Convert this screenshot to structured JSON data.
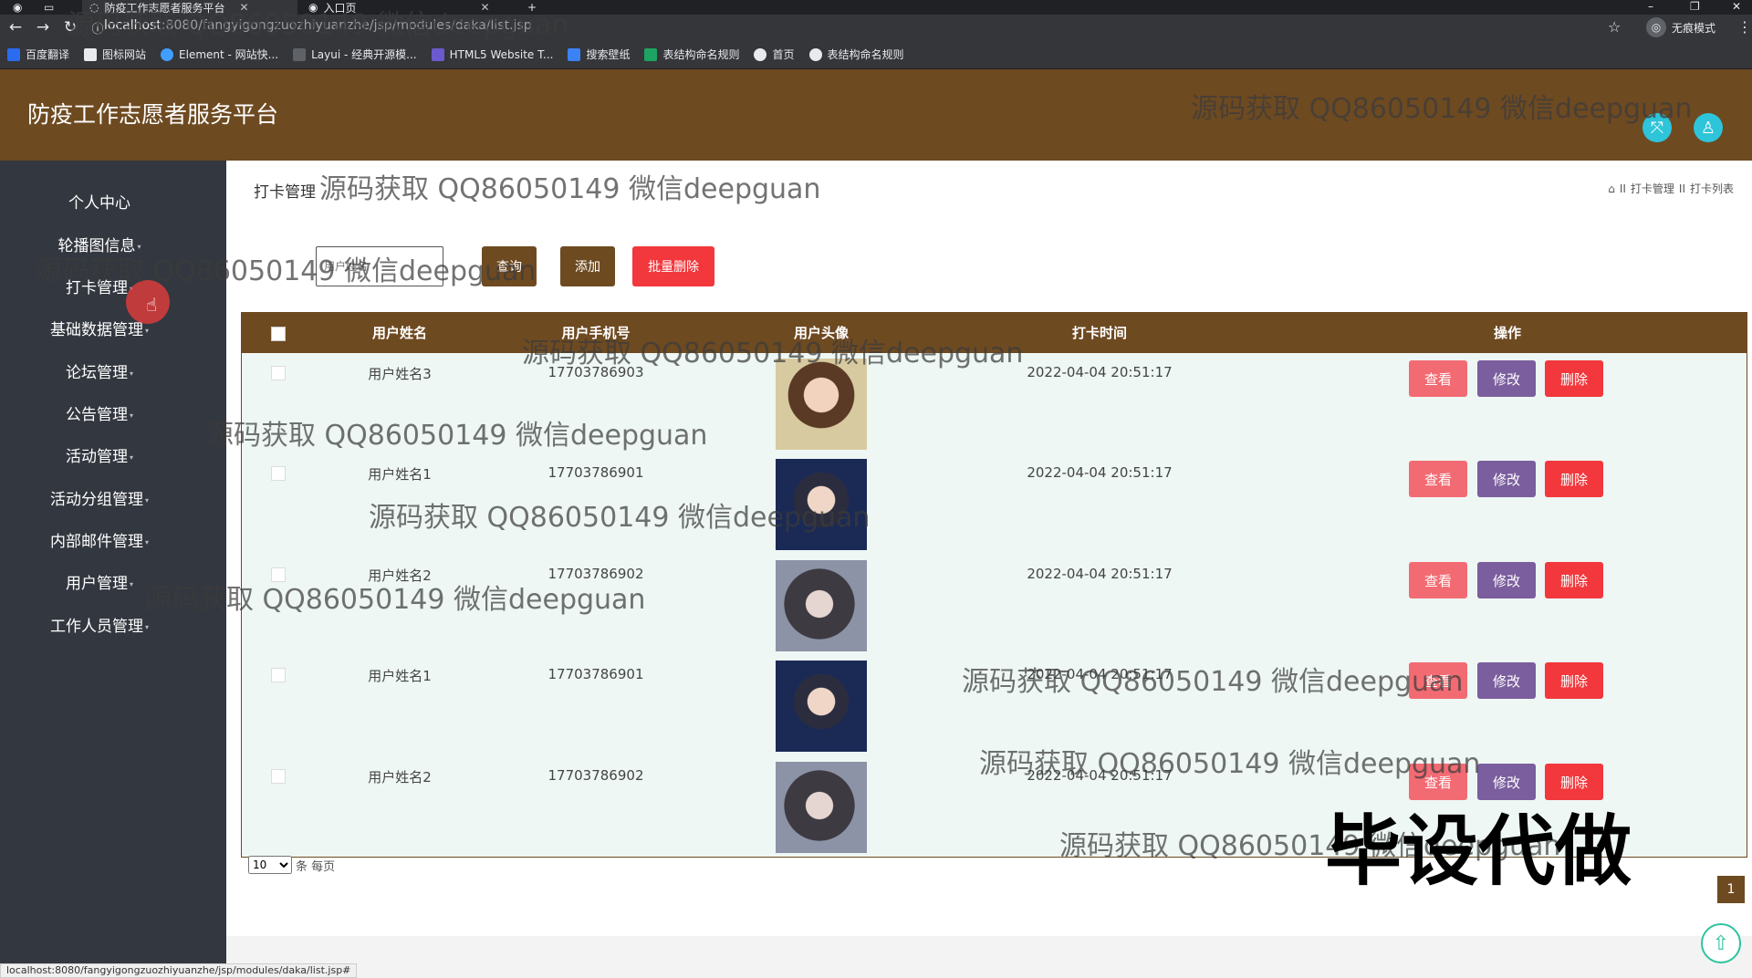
{
  "browser": {
    "tabs": [
      {
        "title": "防疫工作志愿者服务平台"
      },
      {
        "title": "入口页"
      }
    ],
    "url_host": "localhost",
    "url_path": ":8080/fangyigongzuozhiyuanzhe/jsp/modules/daka/list.jsp",
    "incognito_label": "无痕模式",
    "bookmarks": [
      "百度翻译",
      "图标网站",
      "Element - 网站快...",
      "Layui - 经典开源模...",
      "HTML5 Website T...",
      "搜索壁纸",
      "表结构命名规则",
      "首页",
      "表结构命名规则"
    ],
    "status_url": "localhost:8080/fangyigongzuozhiyuanzhe/jsp/modules/daka/list.jsp#"
  },
  "app": {
    "title": "防疫工作志愿者服务平台",
    "accent_color": "#6e4a21",
    "header_icons": [
      "fullscreen-icon",
      "user-icon"
    ]
  },
  "sidebar": {
    "items": [
      "个人中心",
      "轮播图信息",
      "打卡管理",
      "基础数据管理",
      "论坛管理",
      "公告管理",
      "活动管理",
      "活动分组管理",
      "内部邮件管理",
      "用户管理",
      "工作人员管理"
    ]
  },
  "page": {
    "title": "打卡管理",
    "breadcrumb": [
      "打卡管理",
      "打卡列表"
    ],
    "breadcrumb_sep": "II",
    "search_placeholder": "用户姓名",
    "buttons": {
      "query": "查询",
      "add": "添加",
      "batch_delete": "批量删除"
    }
  },
  "table": {
    "headers": [
      "用户姓名",
      "用户手机号",
      "用户头像",
      "打卡时间",
      "操作"
    ],
    "action_labels": {
      "view": "查看",
      "edit": "修改",
      "delete": "删除"
    },
    "rows": [
      {
        "name": "用户姓名3",
        "phone": "17703786903",
        "avatar": "avatar-woman-flowers",
        "time": "2022-04-04 20:51:17"
      },
      {
        "name": "用户姓名1",
        "phone": "17703786901",
        "avatar": "avatar-young-man",
        "time": "2022-04-04 20:51:17"
      },
      {
        "name": "用户姓名2",
        "phone": "17703786902",
        "avatar": "avatar-girl-portrait",
        "time": "2022-04-04 20:51:17"
      },
      {
        "name": "用户姓名1",
        "phone": "17703786901",
        "avatar": "avatar-young-man",
        "time": "2022-04-04 20:51:17"
      },
      {
        "name": "用户姓名2",
        "phone": "17703786902",
        "avatar": "avatar-girl-portrait",
        "time": "2022-04-04 20:51:17"
      }
    ]
  },
  "pager": {
    "page_size": "10",
    "page_size_suffix": "条 每页",
    "current_page": "1"
  },
  "watermarks": {
    "text": "源码获取 QQ86050149 微信deepguan",
    "big_text": "毕设代做"
  }
}
